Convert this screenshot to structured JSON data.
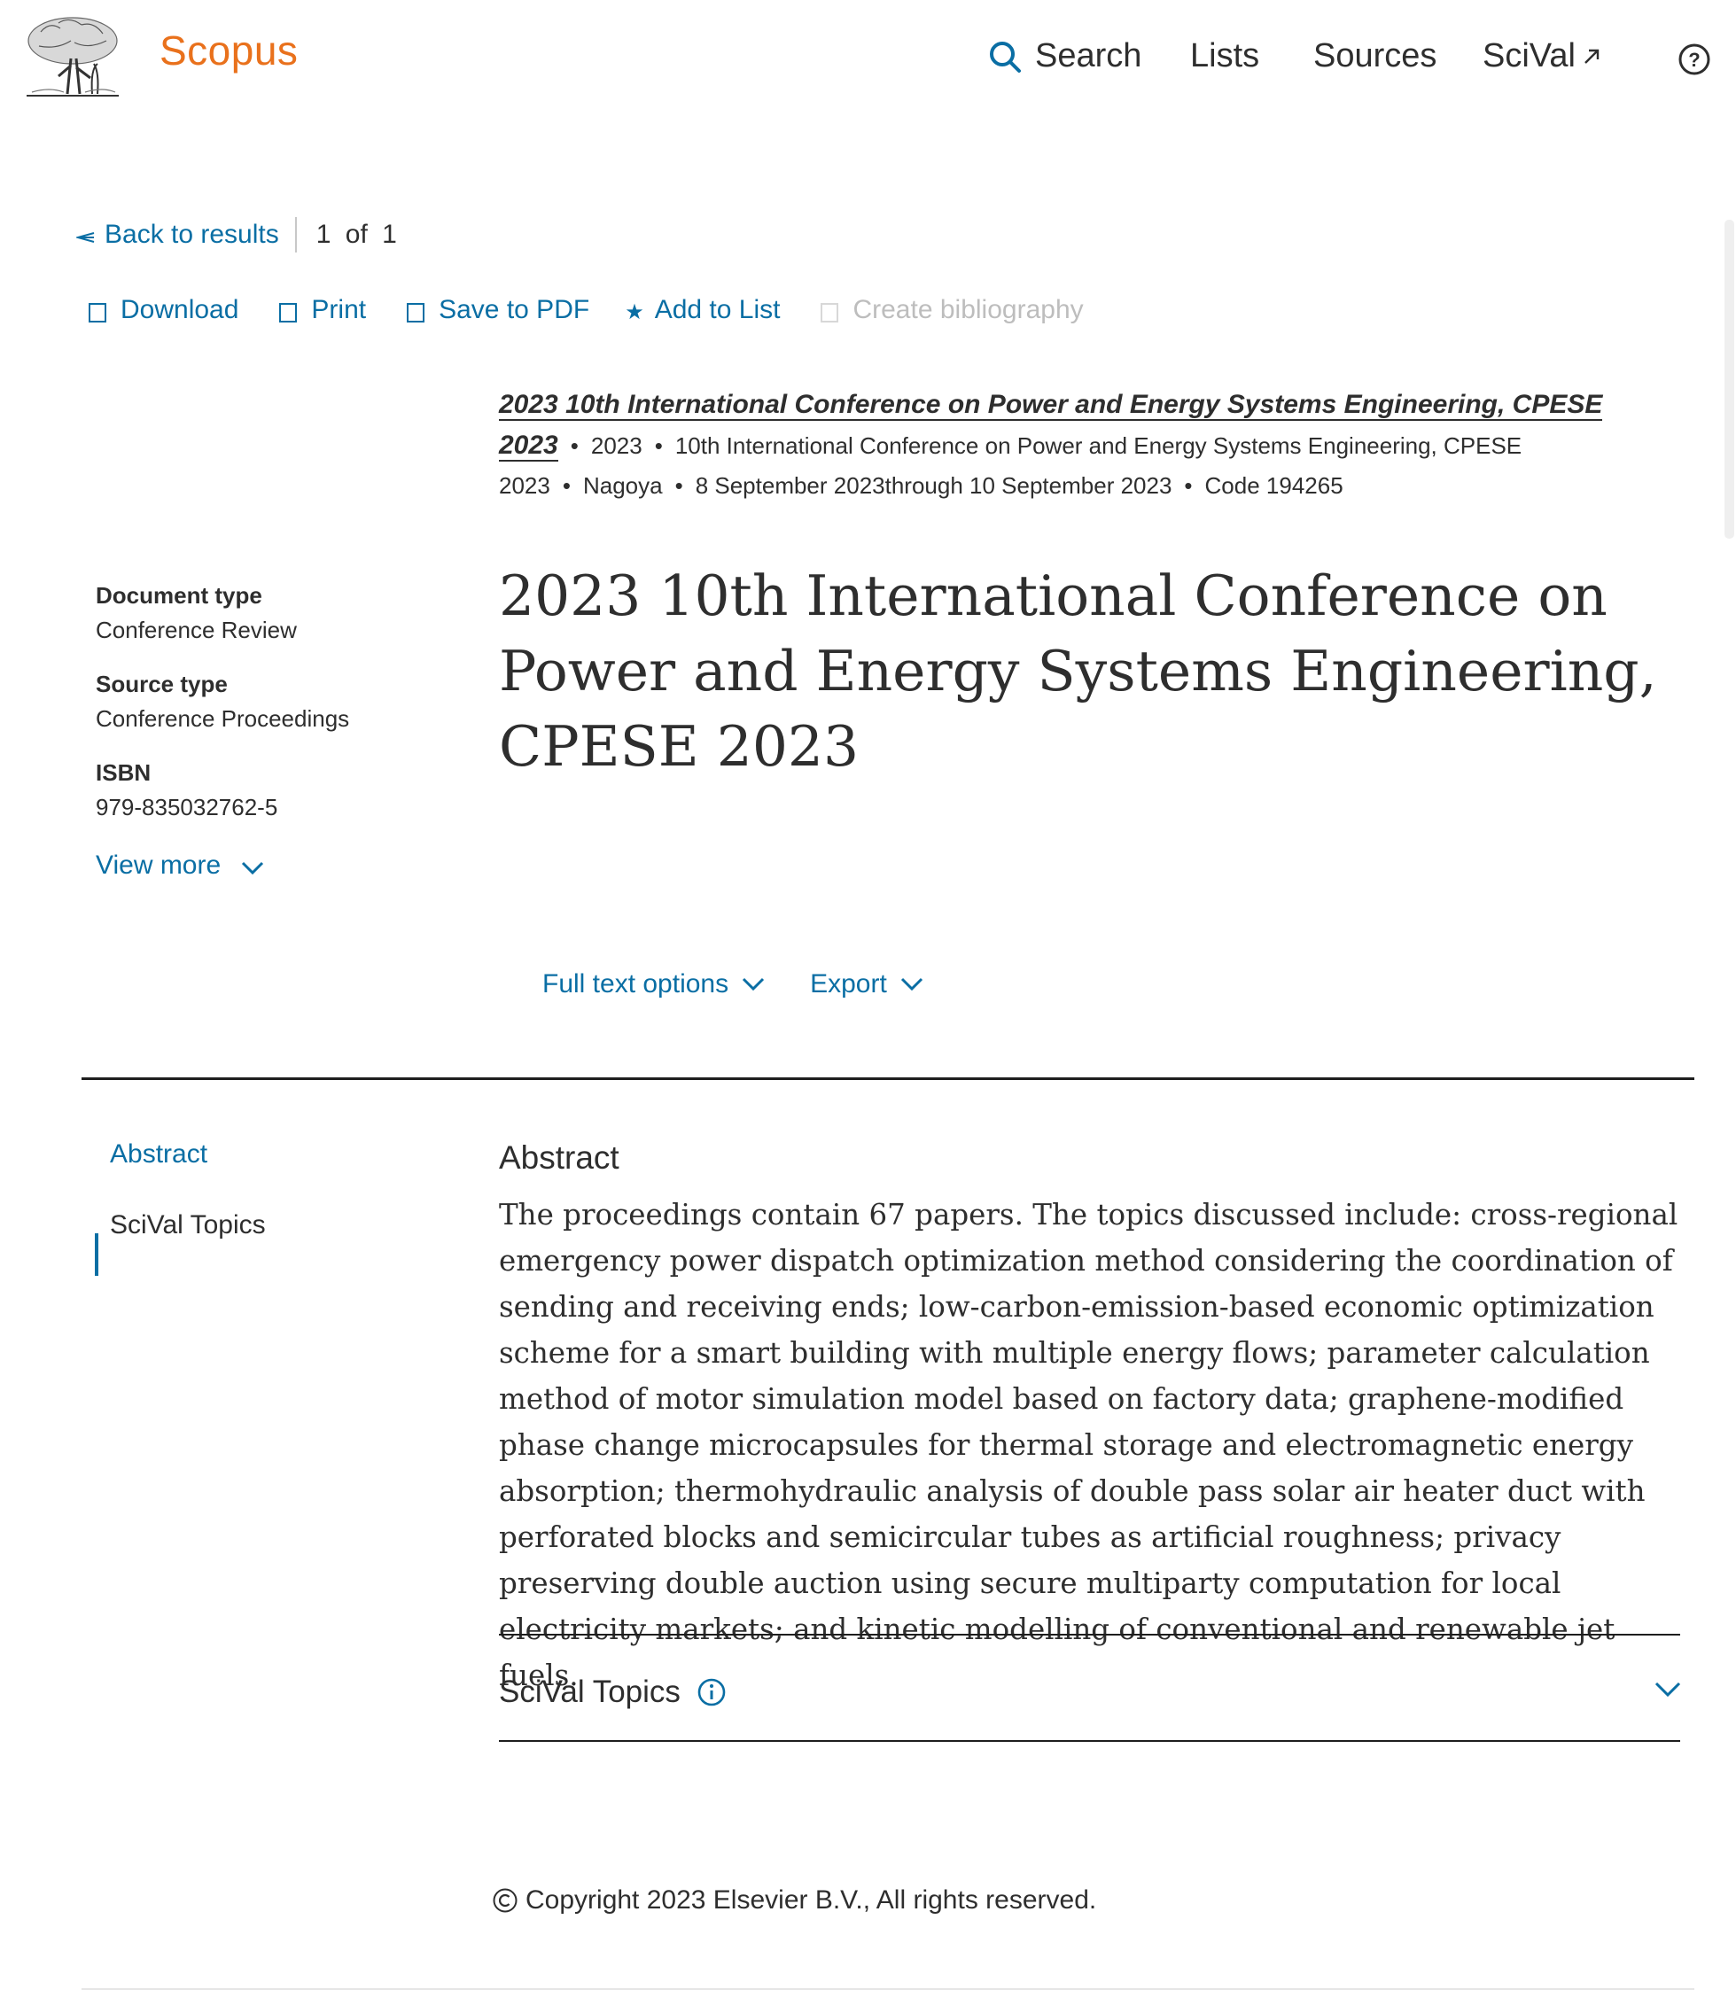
{
  "header": {
    "brand": "Scopus",
    "nav": {
      "search": "Search",
      "lists": "Lists",
      "sources": "Sources",
      "scival": "SciVal"
    },
    "colors": {
      "brand": "#e9711c",
      "link": "#0a6ea4",
      "text": "#2e2e2e"
    }
  },
  "results_nav": {
    "back": "Back to results",
    "pager": "1 of 1"
  },
  "toolbar": {
    "download": "Download",
    "print": "Print",
    "save_pdf": "Save to PDF",
    "add_list": "Add to List",
    "bibliography": "Create bibliography"
  },
  "source_info": {
    "title": "2023 10th International Conference on Power and Energy Systems Engineering, CPESE 2023",
    "year": "2023",
    "conference": "10th International Conference on Power and Energy Systems Engineering, CPESE 2023",
    "location": "Nagoya",
    "dates": "8 September 2023through 10 September 2023",
    "code": "Code 194265"
  },
  "document": {
    "title": "2023 10th International Conference on Power and Energy Systems Engineering, CPESE 2023"
  },
  "meta": {
    "doc_type_label": "Document type",
    "doc_type": "Conference Review",
    "source_type_label": "Source type",
    "source_type": "Conference Proceedings",
    "isbn_label": "ISBN",
    "isbn": "979-835032762-5",
    "view_more": "View more"
  },
  "actions": {
    "full_text": "Full text options",
    "export": "Export"
  },
  "left_nav": {
    "abstract": "Abstract",
    "scival": "SciVal Topics"
  },
  "abstract": {
    "heading": "Abstract",
    "text": "The proceedings contain 67 papers. The topics discussed include: cross-regional emergency power dispatch optimization method considering the coordination of sending and receiving ends; low-carbon-emission-based economic optimization scheme for a smart building with multiple energy flows; parameter calculation method of motor simulation model based on factory data; graphene-modified phase change microcapsules for thermal storage and electromagnetic energy absorption; thermohydraulic analysis of double pass solar air heater duct with perforated blocks and semicircular tubes as artificial roughness; privacy preserving double auction using secure multiparty computation for local electricity markets; and kinetic modelling of conventional and renewable jet fuels."
  },
  "scival": {
    "heading": "SciVal Topics"
  },
  "footer": {
    "copyright": "Copyright 2023 Elsevier B.V., All rights reserved."
  },
  "icons": [
    "elsevier-tree-logo",
    "search-icon",
    "external-link-icon",
    "help-icon",
    "back-arrow-icon",
    "checkbox-icon",
    "star-icon",
    "chevron-down-icon",
    "info-icon",
    "copyright-icon"
  ]
}
